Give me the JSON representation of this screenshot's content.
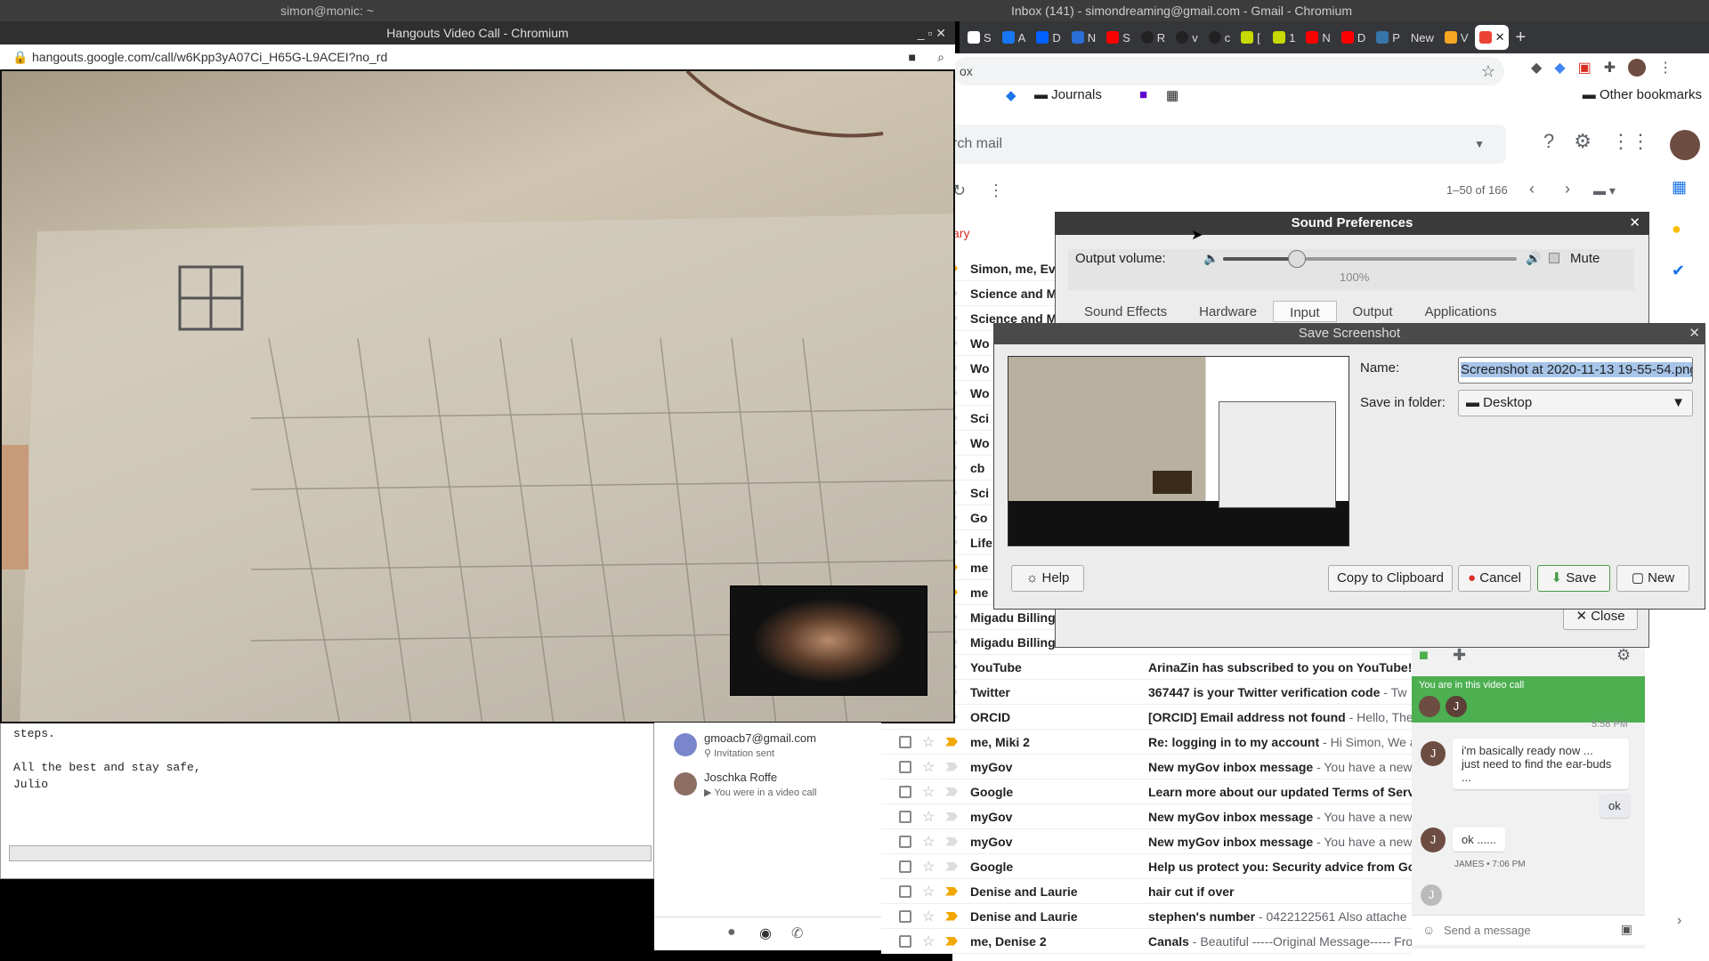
{
  "terminal": {
    "title": "simon@monic: ~",
    "lines": [
      "steps.",
      "",
      "All the best and stay safe,",
      "Julio"
    ]
  },
  "gmail_window": {
    "title": "Inbox (141) - simondreaming@gmail.com - Gmail - Chromium",
    "tabs": [
      "S",
      "A",
      "D",
      "N",
      "S",
      "R",
      "v",
      "c",
      "[",
      "1",
      "N",
      "D",
      "P",
      "New",
      "V",
      ""
    ],
    "omnibox_text": "ox",
    "bookmarks": {
      "journals": "Journals",
      "other": "Other bookmarks"
    },
    "search_placeholder": "rch mail",
    "pagination": "1–50 of 166",
    "category_label": "ary",
    "rows": [
      {
        "sender": "Simon, me, Ev",
        "subject": "",
        "preview": ""
      },
      {
        "sender": "Science and M",
        "subject": "",
        "preview": ""
      },
      {
        "sender": "Science and M",
        "subject": "",
        "preview": ""
      },
      {
        "sender": "Wo",
        "subject": "",
        "preview": ""
      },
      {
        "sender": "Wo",
        "subject": "",
        "preview": ""
      },
      {
        "sender": "Wo",
        "subject": "",
        "preview": ""
      },
      {
        "sender": "Sci",
        "subject": "",
        "preview": ""
      },
      {
        "sender": "Wo",
        "subject": "",
        "preview": ""
      },
      {
        "sender": "cb",
        "subject": "",
        "preview": ""
      },
      {
        "sender": "Sci",
        "subject": "",
        "preview": ""
      },
      {
        "sender": "Go",
        "subject": "",
        "preview": ""
      },
      {
        "sender": "Life",
        "subject": "",
        "preview": ""
      },
      {
        "sender": "me",
        "subject": "",
        "preview": ""
      },
      {
        "sender": "me",
        "subject": "",
        "preview": ""
      },
      {
        "sender": "Migadu Billing",
        "subject": "",
        "preview": ""
      },
      {
        "sender": "Migadu Billing",
        "subject": "",
        "preview": ""
      },
      {
        "sender": "YouTube",
        "subject": "ArinaZin has subscribed to you on YouTube!",
        "preview": ""
      },
      {
        "sender": "Twitter",
        "subject": "367447 is your Twitter verification code",
        "preview": " - Tw"
      },
      {
        "sender": "ORCID",
        "subject": "[ORCID] Email address not found",
        "preview": " - Hello, The"
      },
      {
        "sender": "me, Miki 2",
        "subject": "Re: logging in to my account",
        "preview": " - Hi Simon, We ar"
      },
      {
        "sender": "myGov",
        "subject": "New myGov inbox message",
        "preview": " - You have a new"
      },
      {
        "sender": "Google",
        "subject": "Learn more about our updated Terms of Serv",
        "preview": ""
      },
      {
        "sender": "myGov",
        "subject": "New myGov inbox message",
        "preview": " - You have a new"
      },
      {
        "sender": "myGov",
        "subject": "New myGov inbox message",
        "preview": " - You have a new"
      },
      {
        "sender": "Google",
        "subject": "Help us protect you: Security advice from Go",
        "preview": ""
      },
      {
        "sender": "Denise and Laurie",
        "subject": "hair cut if over",
        "preview": ""
      },
      {
        "sender": "Denise and Laurie",
        "subject": "stephen's number",
        "preview": " - 0422122561 Also attache"
      },
      {
        "sender": "me, Denise 2",
        "subject": "Canals",
        "preview": " - Beautiful -----Original Message----- Fro"
      }
    ]
  },
  "hangouts": {
    "title": "Hangouts Video Call - Chromium",
    "url": "hangouts.google.com/call/w6Kpp3yA07Ci_H65G-L9ACEI?no_rd",
    "contacts": [
      {
        "name": "gmoacb7@gmail.com",
        "status": "Invitation sent"
      },
      {
        "name": "Joschka Roffe",
        "status": "You were in a video call"
      }
    ]
  },
  "chat": {
    "banner": "You are in this video call",
    "time1": "5:58 PM",
    "msg1": "i'm basically ready now ...",
    "msg1b": "just need to find the ear-buds ...",
    "reply": "ok",
    "msg2": "ok ......",
    "meta2": "JAMES • 7:06 PM",
    "avatar_letter": "J",
    "input_placeholder": "Send a message"
  },
  "sound_prefs": {
    "title": "Sound Preferences",
    "output_volume_label": "Output volume:",
    "volume_pct": "100%",
    "volume_level": 0.25,
    "mute_label": "Mute",
    "tabs": [
      "Sound Effects",
      "Hardware",
      "Input",
      "Output",
      "Applications"
    ],
    "close_button": "Close"
  },
  "screenshot_dialog": {
    "title": "Save Screenshot",
    "name_label": "Name:",
    "name_value": "Screenshot at 2020-11-13 19-55-54.png",
    "folder_label": "Save in folder:",
    "folder_value": "Desktop",
    "help": "Help",
    "copy": "Copy to Clipboard",
    "cancel": "Cancel",
    "save": "Save",
    "new": "New"
  },
  "colors": {
    "accent_green": "#4caf50",
    "gmail_red": "#d93025"
  }
}
